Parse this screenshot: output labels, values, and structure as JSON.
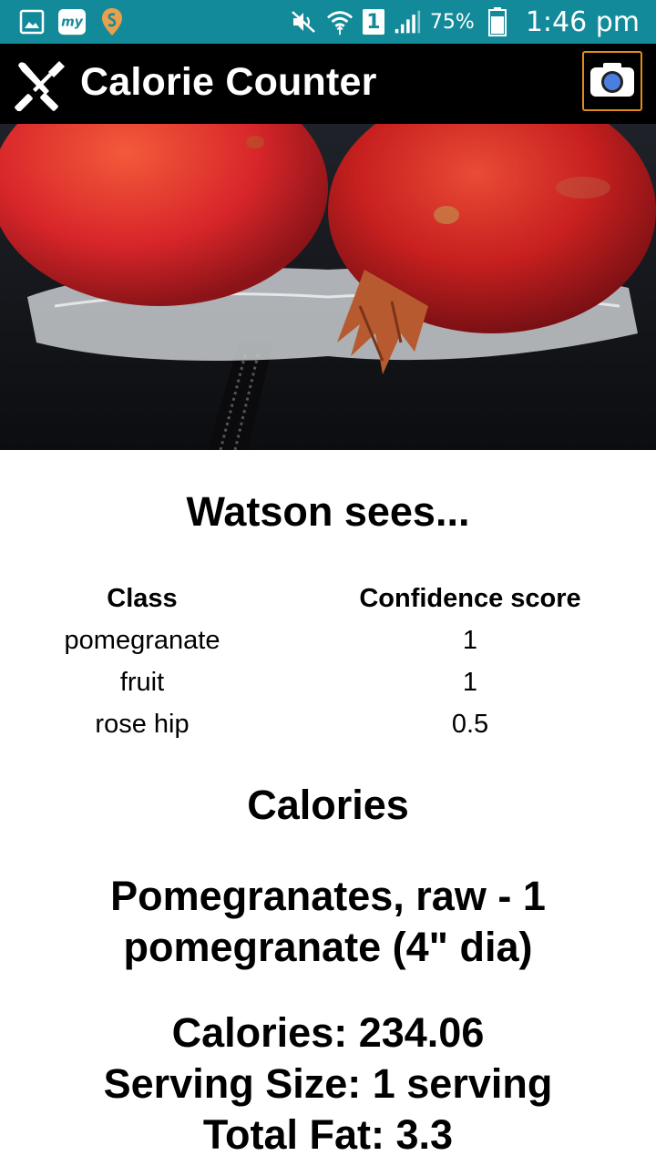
{
  "status_bar": {
    "icons_left": [
      "gallery-icon",
      "mytel-app-icon",
      "swiggy-icon"
    ],
    "icons_right": [
      "mute-icon",
      "wifi-icon",
      "sim-icon",
      "signal-icon",
      "battery-icon"
    ],
    "sim_label": "1",
    "battery_percent": "75%",
    "time": "1:46 pm",
    "color": "#138a99"
  },
  "app_bar": {
    "title": "Calorie Counter",
    "logo_icon": "fork-knife-icon",
    "camera_icon": "camera-icon",
    "camera_border_color": "#e08b1c"
  },
  "photo": {
    "subject": "two pomegranates"
  },
  "watson": {
    "heading": "Watson sees...",
    "columns": [
      "Class",
      "Confidence score"
    ],
    "rows": [
      {
        "class": "pomegranate",
        "score": "1"
      },
      {
        "class": "fruit",
        "score": "1"
      },
      {
        "class": "rose hip",
        "score": "0.5"
      }
    ]
  },
  "calories": {
    "heading": "Calories",
    "food_name": "Pomegranates, raw - 1 pomegranate (4\" dia)",
    "calories_line": "Calories: 234.06",
    "serving_line": "Serving Size: 1 serving",
    "fat_line": "Total Fat: 3.3"
  }
}
